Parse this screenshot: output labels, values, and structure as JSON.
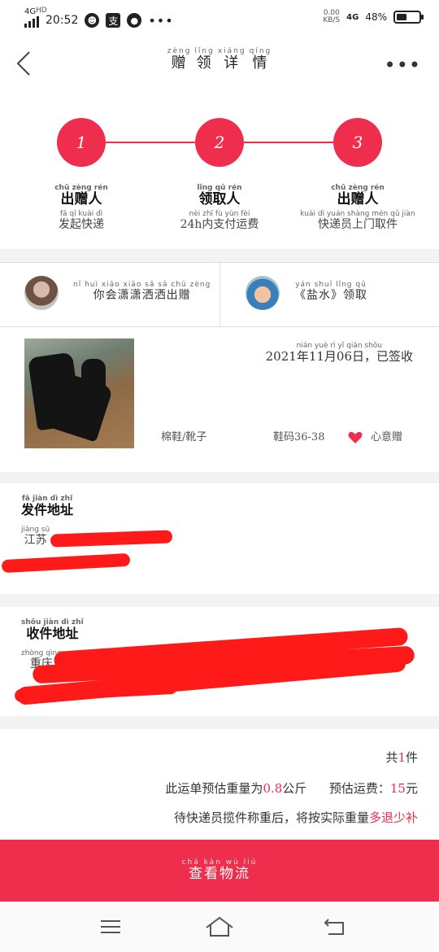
{
  "status_bar": {
    "network": "4G",
    "network_hd": "HD",
    "time": "20:52",
    "speed_value": "0.00",
    "speed_unit": "KB/S",
    "network_right": "4G",
    "battery": "48%",
    "battery_level": 0.48
  },
  "header": {
    "title_chars": [
      "赠",
      "领",
      "详",
      "情"
    ],
    "title_pinyin": [
      "zèng",
      "lǐng",
      "xiáng",
      "qíng"
    ]
  },
  "steps": [
    {
      "number": "1",
      "label": "出赠人",
      "label_pinyin": "chū zèng rén",
      "sub": "发起快递",
      "sub_pinyin": "fā qǐ kuài dì"
    },
    {
      "number": "2",
      "label": "领取人",
      "label_pinyin": "lǐng qǔ rén",
      "sub": "24h内支付运费",
      "sub_pinyin": "nèi zhī fù yùn fèi"
    },
    {
      "number": "3",
      "label": "出赠人",
      "label_pinyin": "chū zèng rén",
      "sub": "快递员上门取件",
      "sub_pinyin": "kuài dì yuán shàng mén qǔ jiàn"
    }
  ],
  "people": {
    "giver_text": "你会潇潇洒洒出赠",
    "giver_pinyin": "nǐ huì xiāo xiāo sǎ sǎ chū zèng",
    "receiver_text": "《盐水》领取",
    "receiver_pinyin": "yán shuǐ lǐng qǔ"
  },
  "product": {
    "date_status": "2021年11月06日，已签收",
    "date_pinyin": "nián yuè rì yǐ qiān shōu",
    "category": "棉鞋/靴子",
    "size": "鞋码36-38",
    "gift_label": "心意赠",
    "heart_color": "#ef2e4d"
  },
  "sender": {
    "title": "发件地址",
    "title_pinyin": "fā jiàn dì zhǐ",
    "line1": "江苏",
    "line1_pinyin": "jiāng sū"
  },
  "receiver": {
    "title": "收件地址",
    "title_pinyin": "shōu jiàn dì zhǐ",
    "line1": "重庆",
    "line1_pinyin": "zhòng qìng"
  },
  "weight": {
    "count_prefix": "共",
    "count_value": "1",
    "count_suffix": "件",
    "est_prefix": "此运单预估重量为",
    "est_value": "0.8",
    "est_unit": "公斤",
    "fee_prefix": "预估运费：",
    "fee_value": "15",
    "fee_unit": "元",
    "note_prefix": "待快递员揽件称重后，将按实际重量",
    "note_red": "多退少补"
  },
  "cta": {
    "label": "查看物流",
    "pinyin": "chá kàn wù liú"
  },
  "colors": {
    "accent": "#ef2e4d",
    "redaction": "#ff1a1a"
  }
}
